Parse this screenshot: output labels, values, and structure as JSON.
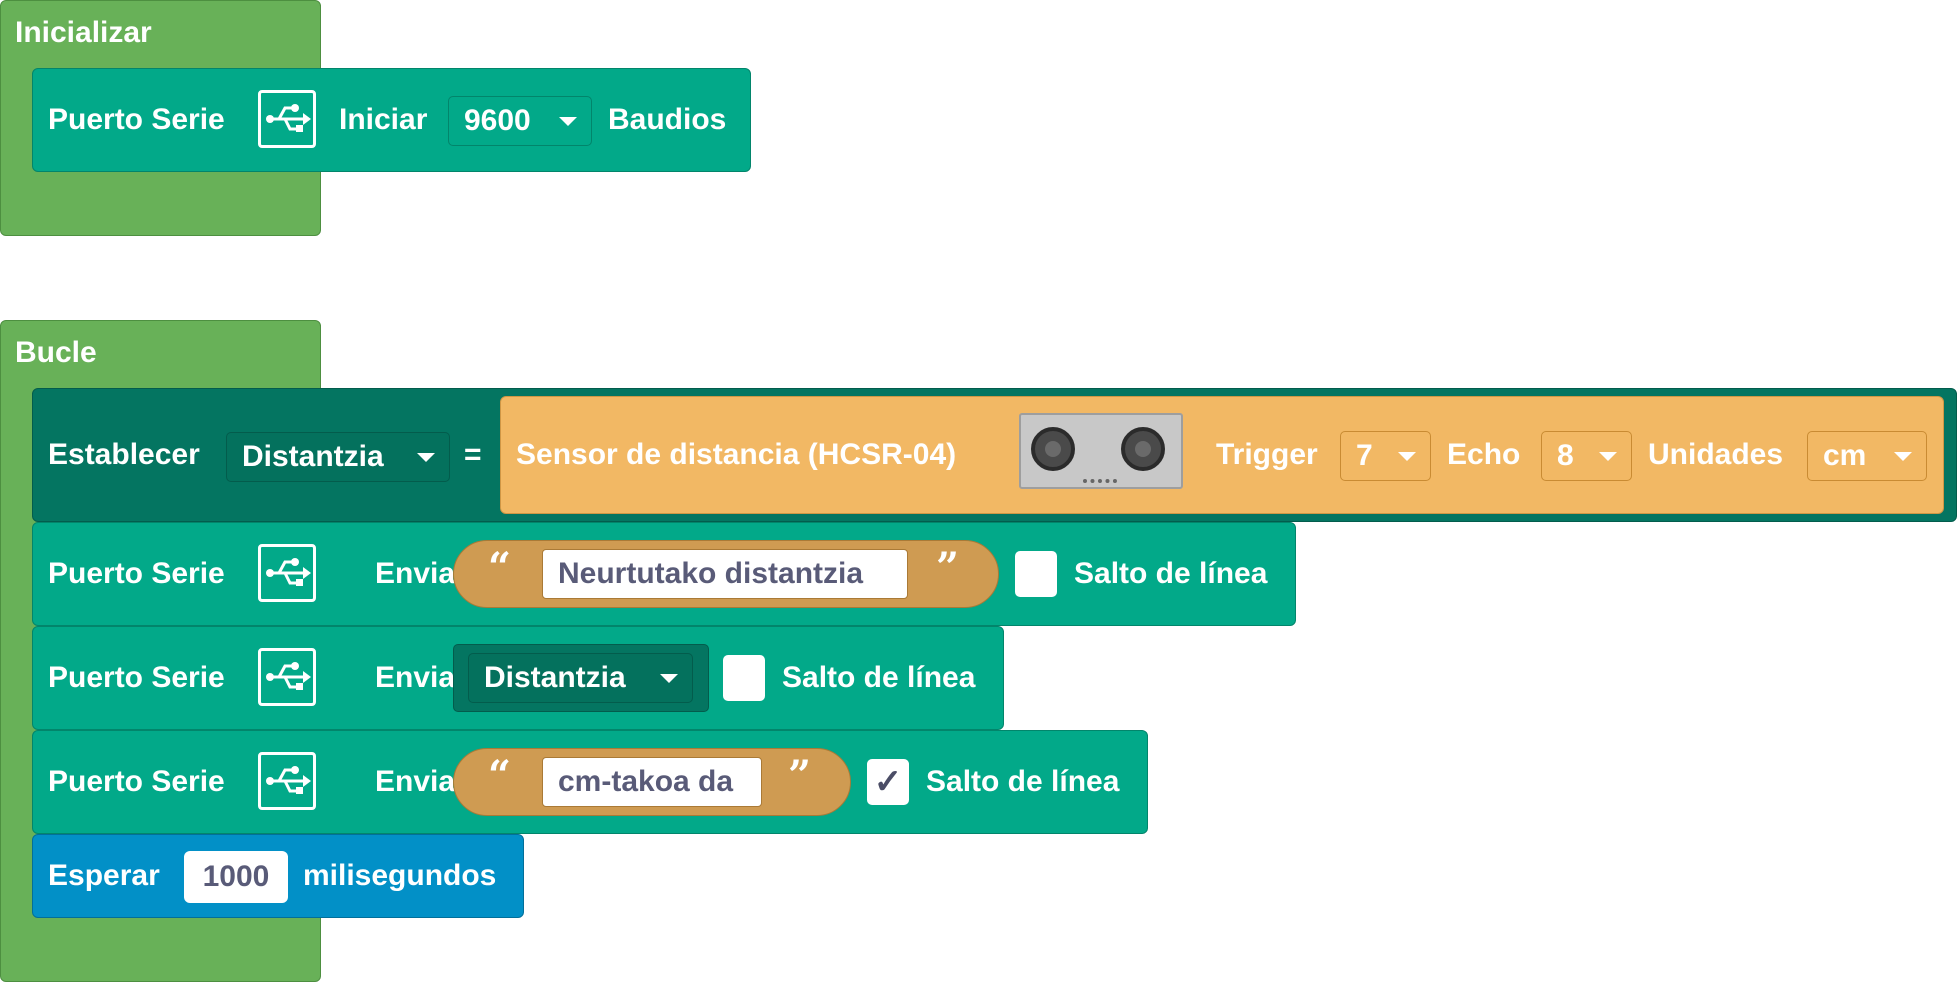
{
  "init": {
    "label": "Inicializar",
    "serial_begin": {
      "label": "Puerto Serie",
      "action": "Iniciar",
      "baud": "9600",
      "suffix": "Baudios",
      "icon": "usb-icon"
    }
  },
  "loop": {
    "label": "Bucle",
    "set_var": {
      "label": "Establecer",
      "variable": "Distantzia",
      "equals": "=",
      "sensor": {
        "label": "Sensor de distancia (HCSR-04)",
        "icon": "ultrasonic-sensor-icon",
        "trigger_label": "Trigger",
        "trigger": "7",
        "echo_label": "Echo",
        "echo": "8",
        "units_label": "Unidades",
        "units": "cm"
      }
    },
    "send1": {
      "label": "Puerto Serie",
      "action": "Enviar",
      "text": "Neurtutako distantzia",
      "open_quote": "“",
      "close_quote": "”",
      "newline_label": "Salto de línea",
      "newline_checked": ""
    },
    "send2": {
      "label": "Puerto Serie",
      "action": "Enviar",
      "variable": "Distantzia",
      "newline_label": "Salto de línea",
      "newline_checked": ""
    },
    "send3": {
      "label": "Puerto Serie",
      "action": "Enviar",
      "text": "cm-takoa da",
      "open_quote": "“",
      "close_quote": "”",
      "newline_label": "Salto de línea",
      "newline_checked": "✓"
    },
    "wait": {
      "label": "Esperar",
      "value": "1000",
      "suffix": "milisegundos"
    }
  },
  "colors": {
    "hat": "#68b158",
    "serial": "#02a989",
    "variable": "#047561",
    "sensor": "#f2b864",
    "text": "#cf9b52",
    "wait": "#0290c7"
  }
}
